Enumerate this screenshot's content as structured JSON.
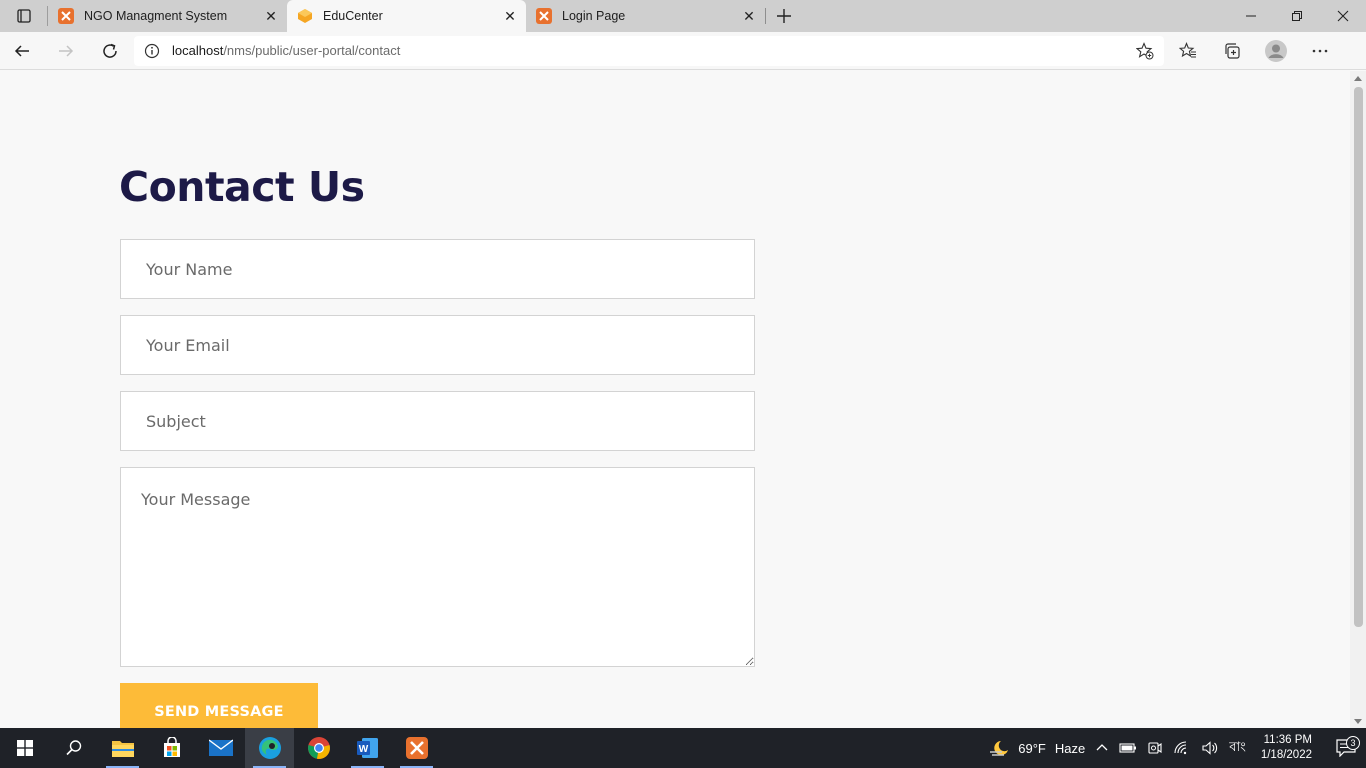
{
  "browser": {
    "tabs": [
      {
        "title": "NGO Managment System",
        "icon": "xampp-icon",
        "active": false
      },
      {
        "title": "EduCenter",
        "icon": "educenter-icon",
        "active": true
      },
      {
        "title": "Login Page",
        "icon": "xampp-icon",
        "active": false
      }
    ],
    "address": {
      "host": "localhost",
      "path": "/nms/public/user-portal/contact"
    }
  },
  "page": {
    "heading": "Contact Us",
    "form": {
      "name_placeholder": "Your Name",
      "email_placeholder": "Your Email",
      "subject_placeholder": "Subject",
      "message_placeholder": "Your Message",
      "submit_label": "SEND MESSAGE"
    }
  },
  "taskbar": {
    "apps": [
      "start-icon",
      "search-icon",
      "file-explorer-icon",
      "store-icon",
      "mail-icon",
      "edge-icon",
      "chrome-icon",
      "word-icon",
      "xampp-icon"
    ],
    "weather": {
      "temp": "69°F",
      "condition": "Haze"
    },
    "language": "বাং",
    "time": "11:36 PM",
    "date": "1/18/2022",
    "notifications": "3"
  },
  "colors": {
    "heading": "#1d1a47",
    "button": "#fdbb38",
    "page_bg": "#f8f8f8"
  }
}
